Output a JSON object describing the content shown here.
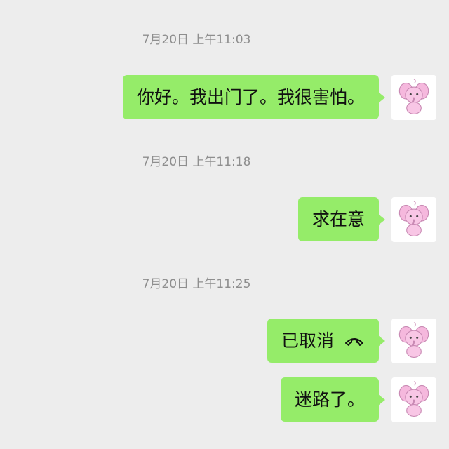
{
  "messages": [
    {
      "timestamp": "7月20日 上午11:03",
      "text": "你好。我出门了。我很害怕。"
    },
    {
      "timestamp": "7月20日 上午11:18",
      "text": "求在意"
    },
    {
      "timestamp": "7月20日 上午11:25",
      "text": "已取消",
      "icon": "hang-up-phone-icon"
    },
    {
      "text": "迷路了。"
    }
  ],
  "avatar": {
    "icon": "pink-elephant-avatar"
  },
  "colors": {
    "background": "#ededed",
    "bubble": "#95ec69",
    "timestamp": "#8e8e8e"
  }
}
